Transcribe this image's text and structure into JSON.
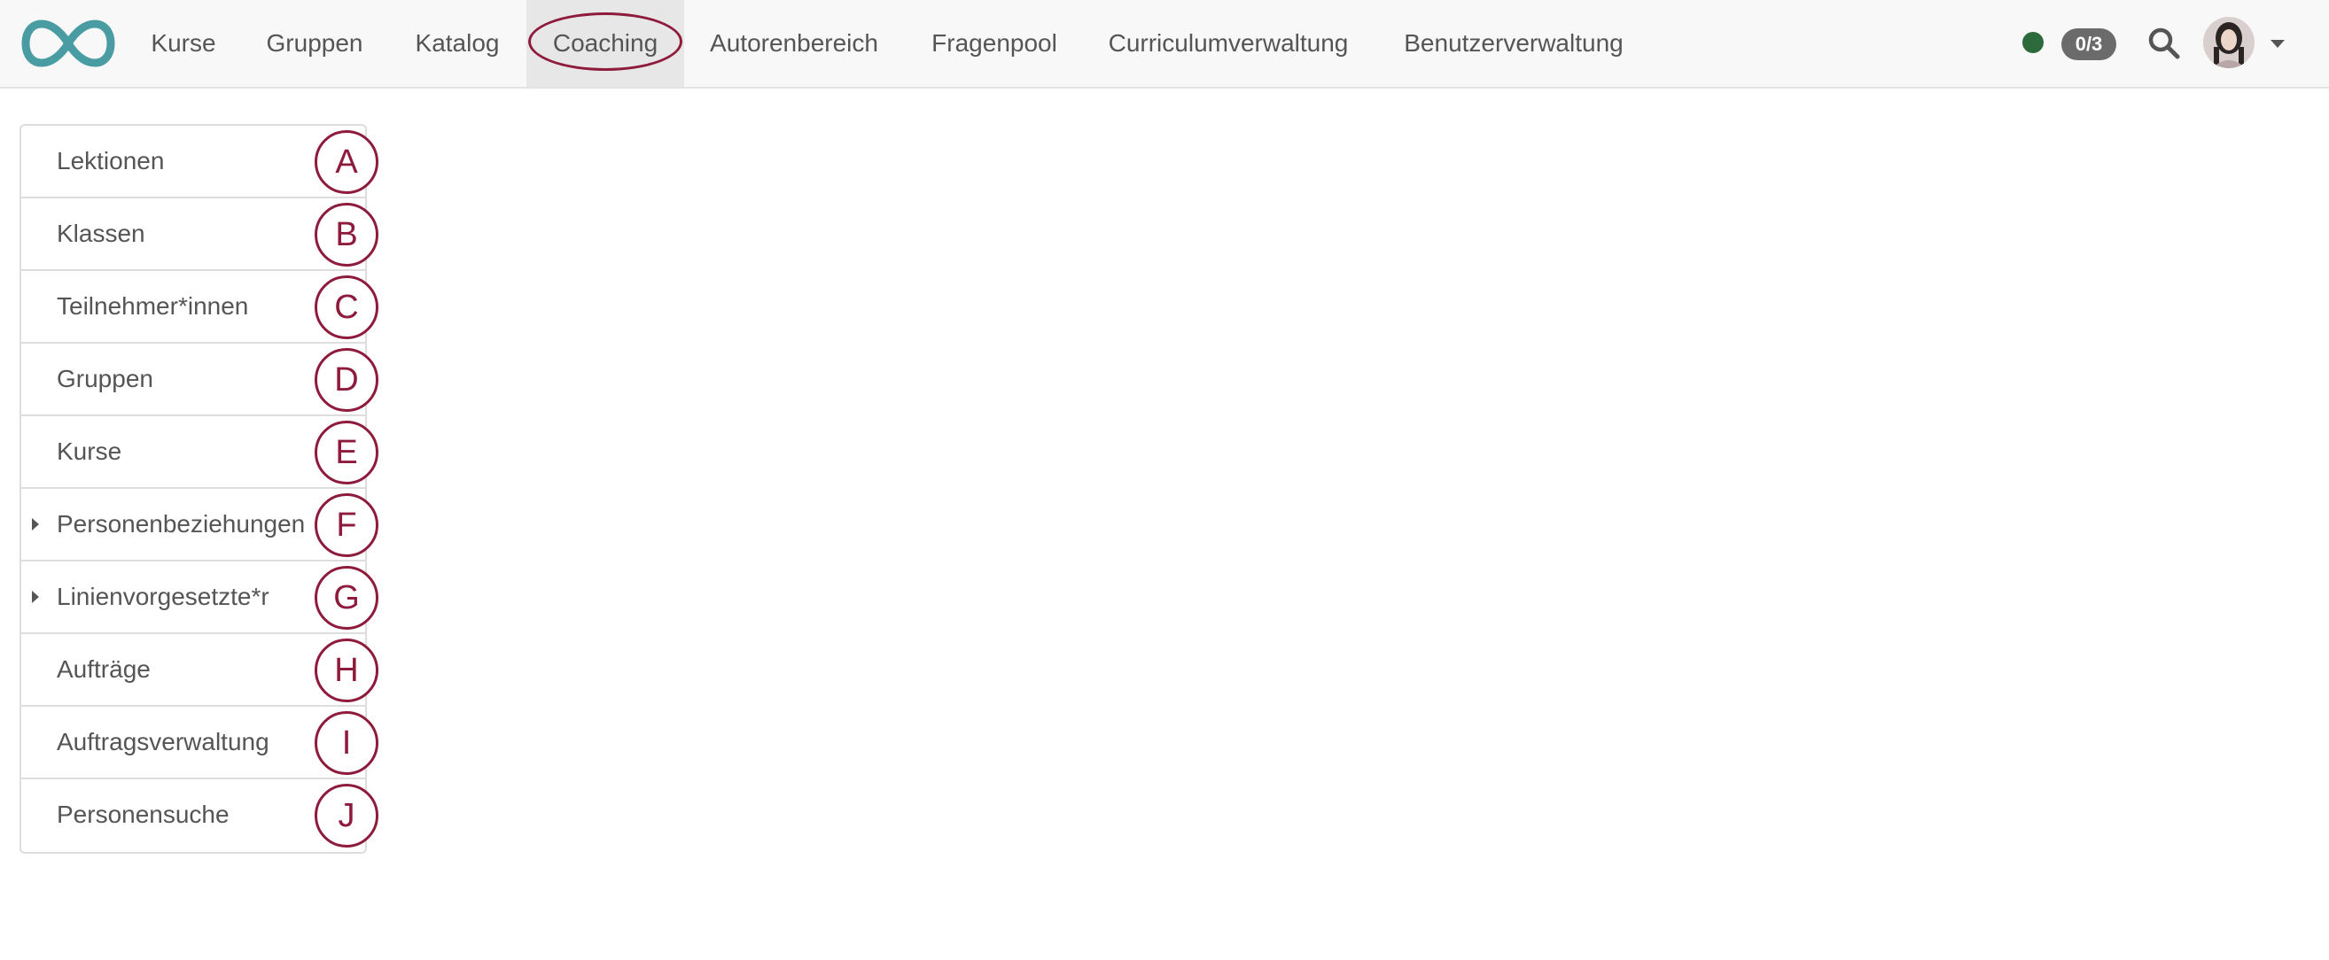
{
  "colors": {
    "accent": "#8e1b3c",
    "logo": "#4a9ca3",
    "status_online": "#2c6a3c",
    "badge_bg": "#6b6b6b",
    "active_tab_bg": "#e7e7e7"
  },
  "header": {
    "logo_icon": "infinity-logo",
    "nav": [
      {
        "label": "Kurse"
      },
      {
        "label": "Gruppen"
      },
      {
        "label": "Katalog"
      },
      {
        "label": "Coaching",
        "active": true
      },
      {
        "label": "Autorenbereich"
      },
      {
        "label": "Fragenpool"
      },
      {
        "label": "Curriculumverwaltung"
      },
      {
        "label": "Benutzerverwaltung"
      }
    ],
    "status_icon": "online-status-dot",
    "badge": "0/3",
    "search_icon": "search-icon",
    "avatar_icon": "user-avatar",
    "menu_icon": "caret-down-icon"
  },
  "sidebar": {
    "items": [
      {
        "label": "Lektionen",
        "marker": "A"
      },
      {
        "label": "Klassen",
        "marker": "B"
      },
      {
        "label": "Teilnehmer*innen",
        "marker": "C"
      },
      {
        "label": "Gruppen",
        "marker": "D"
      },
      {
        "label": "Kurse",
        "marker": "E"
      },
      {
        "label": "Personenbeziehungen",
        "marker": "F",
        "expandable": true
      },
      {
        "label": "Linienvorgesetzte*r",
        "marker": "G",
        "expandable": true
      },
      {
        "label": "Aufträge",
        "marker": "H"
      },
      {
        "label": "Auftragsverwaltung",
        "marker": "I"
      },
      {
        "label": "Personensuche",
        "marker": "J"
      }
    ]
  }
}
